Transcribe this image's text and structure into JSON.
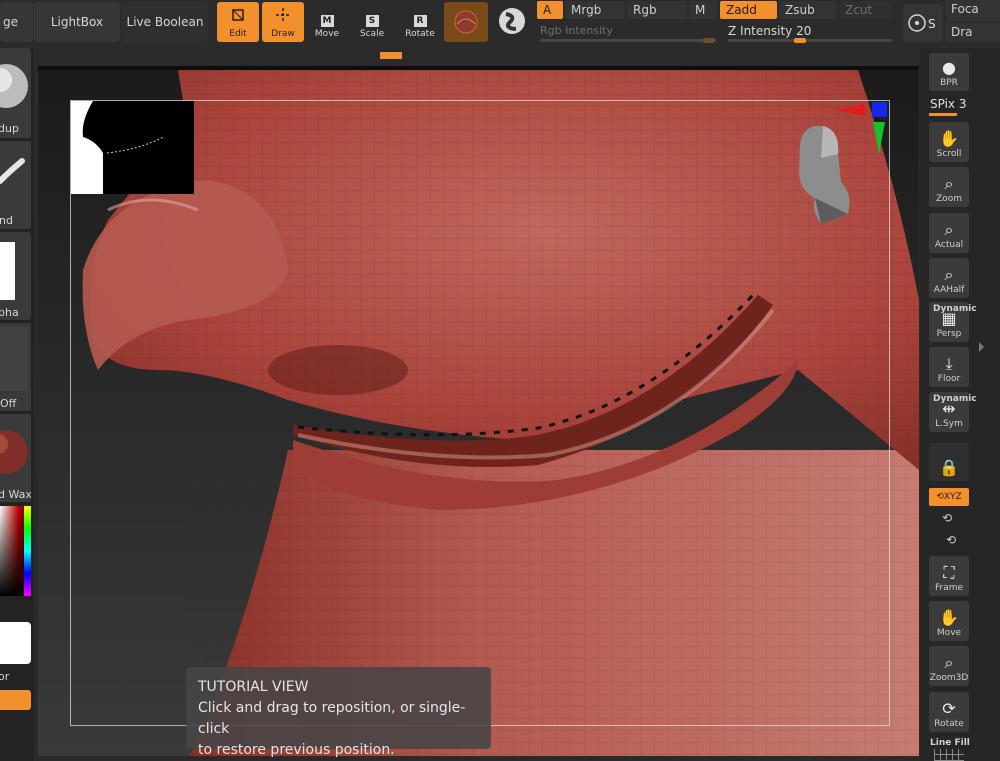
{
  "topbar": {
    "partial_left_label": "ge",
    "lightbox_label": "LightBox",
    "live_boolean_label": "Live Boolean",
    "tools": [
      {
        "label": "Edit",
        "icon": "edit-icon",
        "active": true
      },
      {
        "label": "Draw",
        "icon": "draw-icon",
        "active": true
      },
      {
        "label": "Move",
        "icon": "move-icon",
        "key": "M",
        "active": false
      },
      {
        "label": "Scale",
        "icon": "scale-icon",
        "key": "S",
        "active": false
      },
      {
        "label": "Rotate",
        "icon": "rotate-icon",
        "key": "R",
        "active": false
      }
    ],
    "modes": {
      "a": "A",
      "mrgb": "Mrgb",
      "rgb": "Rgb",
      "m": "M",
      "zadd": "Zadd",
      "zsub": "Zsub",
      "zcut": "Zcut"
    },
    "rgb_intensity_label": "Rgb Intensity",
    "z_intensity_label": "Z Intensity",
    "z_intensity_value": "20",
    "focal_partial": "Foca",
    "draw_partial": "Dra",
    "s_label": "S"
  },
  "left_panel": {
    "captions": [
      "dup",
      "nd",
      "pha",
      "Off",
      "d Wax",
      "or"
    ]
  },
  "right_panel": {
    "bpr_label": "BPR",
    "spix_label": "SPix",
    "spix_value": "3",
    "buttons": [
      {
        "label": "Scroll",
        "icon": "scroll-hand-icon"
      },
      {
        "label": "Zoom",
        "icon": "zoom-icon"
      },
      {
        "label": "Actual",
        "icon": "actual-icon"
      },
      {
        "label": "AAHalf",
        "icon": "aahalf-icon"
      }
    ],
    "persp_top": "Dynamic",
    "persp_label": "Persp",
    "floor_label": "Floor",
    "lsym_top": "Dynamic",
    "lsym_label": "L.Sym",
    "xyz_label": "XYZ",
    "frame_label": "Frame",
    "move_label": "Move",
    "zoom3d_label": "Zoom3D",
    "rotate_label": "Rotate",
    "linefill_label": "Line Fill"
  },
  "tutorial": {
    "title": "TUTORIAL VIEW",
    "line1": "Click and drag to reposition, or single-click",
    "line2": "to restore previous position."
  },
  "colors": {
    "accent": "#f3902e",
    "model": "#a8433b",
    "panel": "#2b2b2b"
  }
}
